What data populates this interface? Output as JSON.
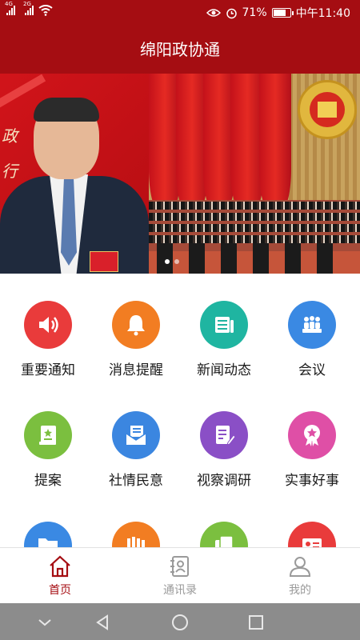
{
  "status_bar": {
    "network_1": "4G",
    "network_2": "2G",
    "battery": "71%",
    "battery_level": 0.71,
    "time": "中午11:40"
  },
  "app_title": "绵阳政协通",
  "banner": {
    "slide_count": 2,
    "active_slide": 0
  },
  "menu": [
    {
      "label": "重要通知",
      "icon": "speaker-icon",
      "color": "#e93b3b"
    },
    {
      "label": "消息提醒",
      "icon": "bell-icon",
      "color": "#f27d22"
    },
    {
      "label": "新闻动态",
      "icon": "newspaper-icon",
      "color": "#1fb5a1"
    },
    {
      "label": "会议",
      "icon": "meeting-icon",
      "color": "#3a89e3"
    },
    {
      "label": "提案",
      "icon": "proposal-book-icon",
      "color": "#7bbf3f"
    },
    {
      "label": "社情民意",
      "icon": "envelope-icon",
      "color": "#3b86e0"
    },
    {
      "label": "视察调研",
      "icon": "document-edit-icon",
      "color": "#8a4fc6"
    },
    {
      "label": "实事好事",
      "icon": "award-badge-icon",
      "color": "#df4fa6"
    },
    {
      "label": "",
      "icon": "folder-icon",
      "color": "#3a89e3"
    },
    {
      "label": "",
      "icon": "books-icon",
      "color": "#f27d22"
    },
    {
      "label": "",
      "icon": "copy-icon",
      "color": "#7bbf3f"
    },
    {
      "label": "",
      "icon": "id-card-icon",
      "color": "#e93b3b"
    }
  ],
  "tabbar": [
    {
      "label": "首页",
      "icon": "home-icon",
      "active": true
    },
    {
      "label": "通讯录",
      "icon": "contacts-icon",
      "active": false
    },
    {
      "label": "我的",
      "icon": "user-icon",
      "active": false
    }
  ],
  "colors": {
    "brand_red": "#a50d12",
    "active_tab": "#a50d12",
    "inactive_tab": "#9a9a9a"
  }
}
